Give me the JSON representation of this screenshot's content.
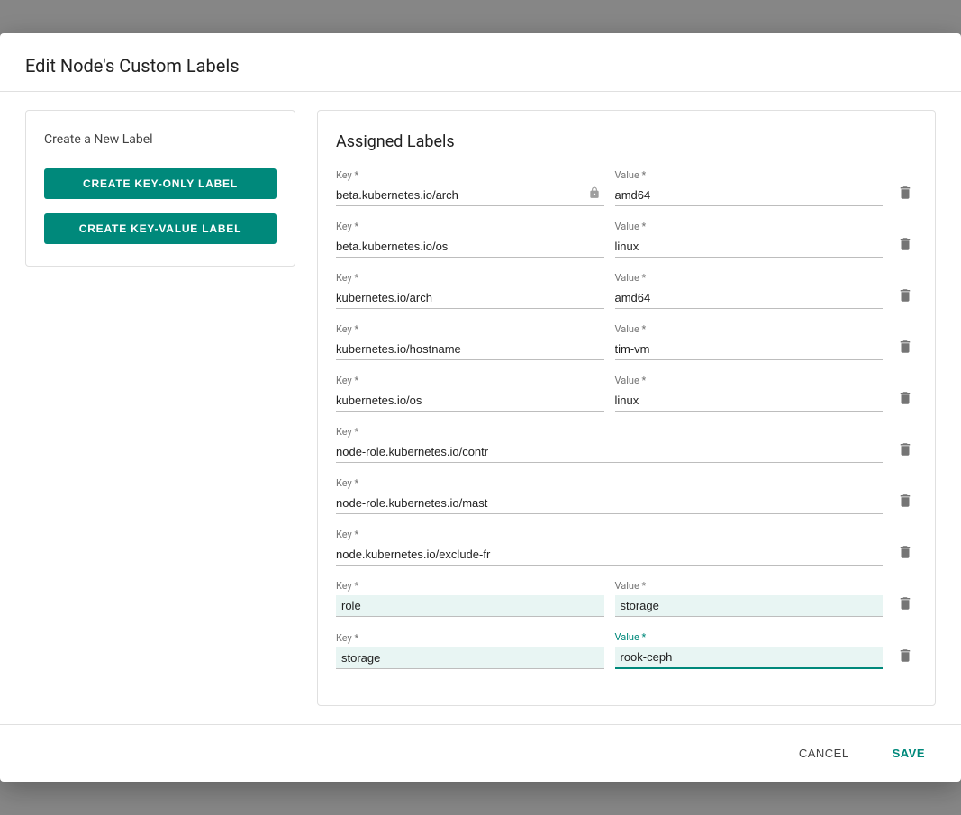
{
  "dialog": {
    "title": "Edit Node's Custom Labels",
    "left_panel": {
      "section_title": "Create a New Label",
      "btn_key_only": "CREATE KEY-ONLY LABEL",
      "btn_key_value": "CREATE KEY-VALUE LABEL"
    },
    "right_panel": {
      "section_title": "Assigned Labels",
      "rows": [
        {
          "key_label": "Key *",
          "key_value": "beta.kubernetes.io/arch",
          "has_lock": true,
          "value_label": "Value *",
          "value_value": "amd64",
          "highlighted": false,
          "value_active": false
        },
        {
          "key_label": "Key *",
          "key_value": "beta.kubernetes.io/os",
          "has_lock": false,
          "value_label": "Value *",
          "value_value": "linux",
          "highlighted": false,
          "value_active": false
        },
        {
          "key_label": "Key *",
          "key_value": "kubernetes.io/arch",
          "has_lock": false,
          "value_label": "Value *",
          "value_value": "amd64",
          "highlighted": false,
          "value_active": false
        },
        {
          "key_label": "Key *",
          "key_value": "kubernetes.io/hostname",
          "has_lock": false,
          "value_label": "Value *",
          "value_value": "tim-vm",
          "highlighted": false,
          "value_active": false
        },
        {
          "key_label": "Key *",
          "key_value": "kubernetes.io/os",
          "has_lock": false,
          "value_label": "Value *",
          "value_value": "linux",
          "highlighted": false,
          "value_active": false
        },
        {
          "key_label": "Key *",
          "key_value": "node-role.kubernetes.io/contr",
          "has_lock": false,
          "value_label": "",
          "value_value": "",
          "highlighted": false,
          "value_active": false
        },
        {
          "key_label": "Key *",
          "key_value": "node-role.kubernetes.io/mast",
          "has_lock": false,
          "value_label": "",
          "value_value": "",
          "highlighted": false,
          "value_active": false
        },
        {
          "key_label": "Key *",
          "key_value": "node.kubernetes.io/exclude-fr",
          "has_lock": false,
          "value_label": "",
          "value_value": "",
          "highlighted": false,
          "value_active": false
        },
        {
          "key_label": "Key *",
          "key_value": "role",
          "has_lock": false,
          "value_label": "Value *",
          "value_value": "storage",
          "highlighted": true,
          "value_active": false
        },
        {
          "key_label": "Key *",
          "key_value": "storage",
          "has_lock": false,
          "value_label": "Value *",
          "value_value": "rook-ceph",
          "highlighted": true,
          "value_active": true
        }
      ]
    },
    "footer": {
      "cancel_label": "CANCEL",
      "save_label": "SAVE"
    }
  }
}
